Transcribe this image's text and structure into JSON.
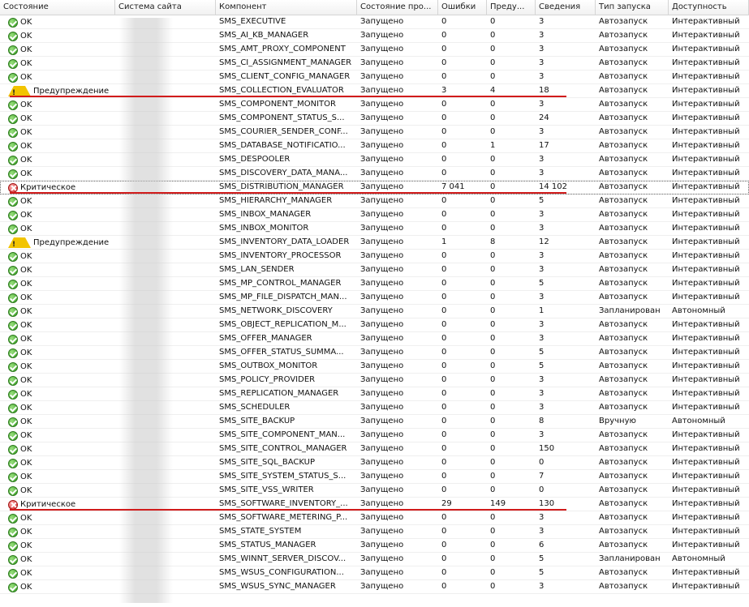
{
  "columns": [
    "Состояние",
    "Система сайта",
    "Компонент",
    "Состояние про...",
    "Ошибки",
    "Преду...",
    "Сведения",
    "Тип запуска",
    "Доступность"
  ],
  "colors": {
    "highlight": "#d11b1b",
    "ok": "#2f9a1c",
    "warning": "#f2c400",
    "critical": "#d22626"
  },
  "rows": [
    {
      "status": "ok",
      "state": "OK",
      "site": "",
      "component": "SMS_EXECUTIVE",
      "run": "Запущено",
      "errors": "0",
      "warnings": "0",
      "info": "3",
      "start": "Автозапуск",
      "avail": "Интерактивный"
    },
    {
      "status": "ok",
      "state": "OK",
      "site": "",
      "component": "SMS_AI_KB_MANAGER",
      "run": "Запущено",
      "errors": "0",
      "warnings": "0",
      "info": "3",
      "start": "Автозапуск",
      "avail": "Интерактивный"
    },
    {
      "status": "ok",
      "state": "OK",
      "site": "",
      "component": "SMS_AMT_PROXY_COMPONENT",
      "run": "Запущено",
      "errors": "0",
      "warnings": "0",
      "info": "3",
      "start": "Автозапуск",
      "avail": "Интерактивный"
    },
    {
      "status": "ok",
      "state": "OK",
      "site": "",
      "component": "SMS_CI_ASSIGNMENT_MANAGER",
      "run": "Запущено",
      "errors": "0",
      "warnings": "0",
      "info": "3",
      "start": "Автозапуск",
      "avail": "Интерактивный"
    },
    {
      "status": "ok",
      "state": "OK",
      "site": "",
      "component": "SMS_CLIENT_CONFIG_MANAGER",
      "run": "Запущено",
      "errors": "0",
      "warnings": "0",
      "info": "3",
      "start": "Автозапуск",
      "avail": "Интерактивный"
    },
    {
      "status": "warn",
      "state": "Предупреждение",
      "site": "",
      "component": "SMS_COLLECTION_EVALUATOR",
      "run": "Запущено",
      "errors": "3",
      "warnings": "4",
      "info": "18",
      "start": "Автозапуск",
      "avail": "Интерактивный"
    },
    {
      "status": "ok",
      "state": "OK",
      "site": "",
      "component": "SMS_COMPONENT_MONITOR",
      "run": "Запущено",
      "errors": "0",
      "warnings": "0",
      "info": "3",
      "start": "Автозапуск",
      "avail": "Интерактивный"
    },
    {
      "status": "ok",
      "state": "OK",
      "site": "",
      "component": "SMS_COMPONENT_STATUS_S...",
      "run": "Запущено",
      "errors": "0",
      "warnings": "0",
      "info": "24",
      "start": "Автозапуск",
      "avail": "Интерактивный"
    },
    {
      "status": "ok",
      "state": "OK",
      "site": "",
      "component": "SMS_COURIER_SENDER_CONF...",
      "run": "Запущено",
      "errors": "0",
      "warnings": "0",
      "info": "3",
      "start": "Автозапуск",
      "avail": "Интерактивный"
    },
    {
      "status": "ok",
      "state": "OK",
      "site": "",
      "component": "SMS_DATABASE_NOTIFICATIO...",
      "run": "Запущено",
      "errors": "0",
      "warnings": "1",
      "info": "17",
      "start": "Автозапуск",
      "avail": "Интерактивный"
    },
    {
      "status": "ok",
      "state": "OK",
      "site": "",
      "component": "SMS_DESPOOLER",
      "run": "Запущено",
      "errors": "0",
      "warnings": "0",
      "info": "3",
      "start": "Автозапуск",
      "avail": "Интерактивный"
    },
    {
      "status": "ok",
      "state": "OK",
      "site": "",
      "component": "SMS_DISCOVERY_DATA_MANA...",
      "run": "Запущено",
      "errors": "0",
      "warnings": "0",
      "info": "3",
      "start": "Автозапуск",
      "avail": "Интерактивный"
    },
    {
      "status": "crit",
      "state": "Критическое",
      "site": "",
      "component": "SMS_DISTRIBUTION_MANAGER",
      "run": "Запущено",
      "errors": "7 041",
      "warnings": "0",
      "info": "14 102",
      "start": "Автозапуск",
      "avail": "Интерактивный",
      "selected": true
    },
    {
      "status": "ok",
      "state": "OK",
      "site": "",
      "component": "SMS_HIERARCHY_MANAGER",
      "run": "Запущено",
      "errors": "0",
      "warnings": "0",
      "info": "5",
      "start": "Автозапуск",
      "avail": "Интерактивный"
    },
    {
      "status": "ok",
      "state": "OK",
      "site": "",
      "component": "SMS_INBOX_MANAGER",
      "run": "Запущено",
      "errors": "0",
      "warnings": "0",
      "info": "3",
      "start": "Автозапуск",
      "avail": "Интерактивный"
    },
    {
      "status": "ok",
      "state": "OK",
      "site": "",
      "component": "SMS_INBOX_MONITOR",
      "run": "Запущено",
      "errors": "0",
      "warnings": "0",
      "info": "3",
      "start": "Автозапуск",
      "avail": "Интерактивный"
    },
    {
      "status": "warn",
      "state": "Предупреждение",
      "site": "",
      "component": "SMS_INVENTORY_DATA_LOADER",
      "run": "Запущено",
      "errors": "1",
      "warnings": "8",
      "info": "12",
      "start": "Автозапуск",
      "avail": "Интерактивный"
    },
    {
      "status": "ok",
      "state": "OK",
      "site": "",
      "component": "SMS_INVENTORY_PROCESSOR",
      "run": "Запущено",
      "errors": "0",
      "warnings": "0",
      "info": "3",
      "start": "Автозапуск",
      "avail": "Интерактивный"
    },
    {
      "status": "ok",
      "state": "OK",
      "site": "",
      "component": "SMS_LAN_SENDER",
      "run": "Запущено",
      "errors": "0",
      "warnings": "0",
      "info": "3",
      "start": "Автозапуск",
      "avail": "Интерактивный"
    },
    {
      "status": "ok",
      "state": "OK",
      "site": "",
      "component": "SMS_MP_CONTROL_MANAGER",
      "run": "Запущено",
      "errors": "0",
      "warnings": "0",
      "info": "5",
      "start": "Автозапуск",
      "avail": "Интерактивный"
    },
    {
      "status": "ok",
      "state": "OK",
      "site": "",
      "component": "SMS_MP_FILE_DISPATCH_MAN...",
      "run": "Запущено",
      "errors": "0",
      "warnings": "0",
      "info": "3",
      "start": "Автозапуск",
      "avail": "Интерактивный"
    },
    {
      "status": "ok",
      "state": "OK",
      "site": "",
      "component": "SMS_NETWORK_DISCOVERY",
      "run": "Запущено",
      "errors": "0",
      "warnings": "0",
      "info": "1",
      "start": "Запланирован",
      "avail": "Автономный"
    },
    {
      "status": "ok",
      "state": "OK",
      "site": "",
      "component": "SMS_OBJECT_REPLICATION_M...",
      "run": "Запущено",
      "errors": "0",
      "warnings": "0",
      "info": "3",
      "start": "Автозапуск",
      "avail": "Интерактивный"
    },
    {
      "status": "ok",
      "state": "OK",
      "site": "",
      "component": "SMS_OFFER_MANAGER",
      "run": "Запущено",
      "errors": "0",
      "warnings": "0",
      "info": "3",
      "start": "Автозапуск",
      "avail": "Интерактивный"
    },
    {
      "status": "ok",
      "state": "OK",
      "site": "",
      "component": "SMS_OFFER_STATUS_SUMMA...",
      "run": "Запущено",
      "errors": "0",
      "warnings": "0",
      "info": "5",
      "start": "Автозапуск",
      "avail": "Интерактивный"
    },
    {
      "status": "ok",
      "state": "OK",
      "site": "",
      "component": "SMS_OUTBOX_MONITOR",
      "run": "Запущено",
      "errors": "0",
      "warnings": "0",
      "info": "5",
      "start": "Автозапуск",
      "avail": "Интерактивный"
    },
    {
      "status": "ok",
      "state": "OK",
      "site": "",
      "component": "SMS_POLICY_PROVIDER",
      "run": "Запущено",
      "errors": "0",
      "warnings": "0",
      "info": "3",
      "start": "Автозапуск",
      "avail": "Интерактивный"
    },
    {
      "status": "ok",
      "state": "OK",
      "site": "",
      "component": "SMS_REPLICATION_MANAGER",
      "run": "Запущено",
      "errors": "0",
      "warnings": "0",
      "info": "3",
      "start": "Автозапуск",
      "avail": "Интерактивный"
    },
    {
      "status": "ok",
      "state": "OK",
      "site": "",
      "component": "SMS_SCHEDULER",
      "run": "Запущено",
      "errors": "0",
      "warnings": "0",
      "info": "3",
      "start": "Автозапуск",
      "avail": "Интерактивный"
    },
    {
      "status": "ok",
      "state": "OK",
      "site": "",
      "component": "SMS_SITE_BACKUP",
      "run": "Запущено",
      "errors": "0",
      "warnings": "0",
      "info": "8",
      "start": "Вручную",
      "avail": "Автономный"
    },
    {
      "status": "ok",
      "state": "OK",
      "site": "",
      "component": "SMS_SITE_COMPONENT_MAN...",
      "run": "Запущено",
      "errors": "0",
      "warnings": "0",
      "info": "3",
      "start": "Автозапуск",
      "avail": "Интерактивный"
    },
    {
      "status": "ok",
      "state": "OK",
      "site": "",
      "component": "SMS_SITE_CONTROL_MANAGER",
      "run": "Запущено",
      "errors": "0",
      "warnings": "0",
      "info": "150",
      "start": "Автозапуск",
      "avail": "Интерактивный"
    },
    {
      "status": "ok",
      "state": "OK",
      "site": "",
      "component": "SMS_SITE_SQL_BACKUP",
      "run": "Запущено",
      "errors": "0",
      "warnings": "0",
      "info": "0",
      "start": "Автозапуск",
      "avail": "Интерактивный"
    },
    {
      "status": "ok",
      "state": "OK",
      "site": "",
      "component": "SMS_SITE_SYSTEM_STATUS_S...",
      "run": "Запущено",
      "errors": "0",
      "warnings": "0",
      "info": "7",
      "start": "Автозапуск",
      "avail": "Интерактивный"
    },
    {
      "status": "ok",
      "state": "OK",
      "site": "",
      "component": "SMS_SITE_VSS_WRITER",
      "run": "Запущено",
      "errors": "0",
      "warnings": "0",
      "info": "0",
      "start": "Автозапуск",
      "avail": "Интерактивный"
    },
    {
      "status": "crit",
      "state": "Критическое",
      "site": "",
      "component": "SMS_SOFTWARE_INVENTORY_...",
      "run": "Запущено",
      "errors": "29",
      "warnings": "149",
      "info": "130",
      "start": "Автозапуск",
      "avail": "Интерактивный"
    },
    {
      "status": "ok",
      "state": "OK",
      "site": "",
      "component": "SMS_SOFTWARE_METERING_P...",
      "run": "Запущено",
      "errors": "0",
      "warnings": "0",
      "info": "3",
      "start": "Автозапуск",
      "avail": "Интерактивный"
    },
    {
      "status": "ok",
      "state": "OK",
      "site": "",
      "component": "SMS_STATE_SYSTEM",
      "run": "Запущено",
      "errors": "0",
      "warnings": "0",
      "info": "3",
      "start": "Автозапуск",
      "avail": "Интерактивный"
    },
    {
      "status": "ok",
      "state": "OK",
      "site": "",
      "component": "SMS_STATUS_MANAGER",
      "run": "Запущено",
      "errors": "0",
      "warnings": "0",
      "info": "6",
      "start": "Автозапуск",
      "avail": "Интерактивный"
    },
    {
      "status": "ok",
      "state": "OK",
      "site": "",
      "component": "SMS_WINNT_SERVER_DISCOV...",
      "run": "Запущено",
      "errors": "0",
      "warnings": "0",
      "info": "5",
      "start": "Запланирован",
      "avail": "Автономный"
    },
    {
      "status": "ok",
      "state": "OK",
      "site": "",
      "component": "SMS_WSUS_CONFIGURATION...",
      "run": "Запущено",
      "errors": "0",
      "warnings": "0",
      "info": "5",
      "start": "Автозапуск",
      "avail": "Интерактивный"
    },
    {
      "status": "ok",
      "state": "OK",
      "site": "",
      "component": "SMS_WSUS_SYNC_MANAGER",
      "run": "Запущено",
      "errors": "0",
      "warnings": "0",
      "info": "3",
      "start": "Автозапуск",
      "avail": "Интерактивный"
    }
  ],
  "annotations": [
    {
      "row": 5,
      "name": "underline-collection-evaluator"
    },
    {
      "row": 12,
      "name": "underline-distribution-manager"
    },
    {
      "row": 35,
      "name": "underline-software-inventory"
    }
  ]
}
